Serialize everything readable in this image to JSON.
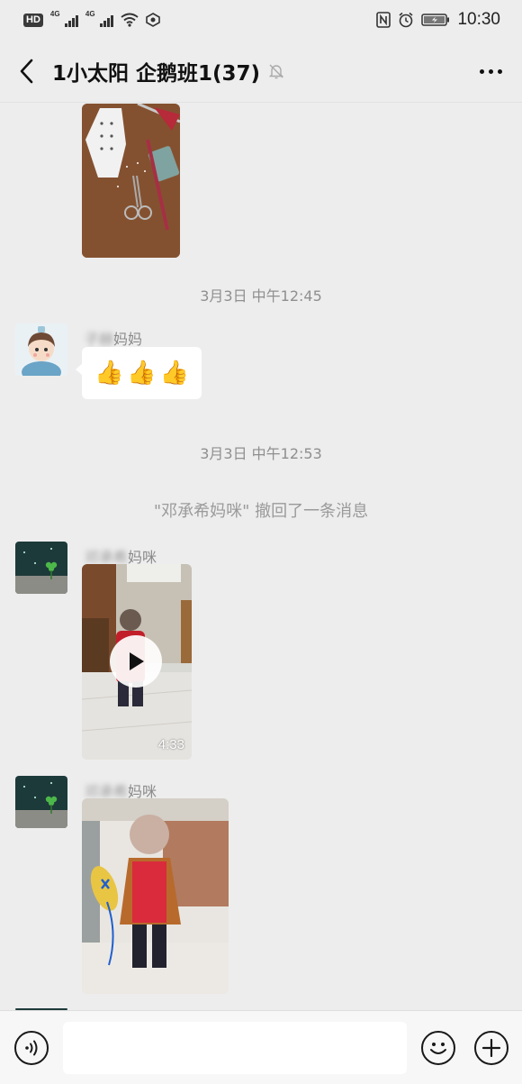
{
  "status_bar": {
    "hd_label": "HD",
    "network_1": "4G",
    "network_2": "4G",
    "time": "10:30",
    "icons": [
      "hd-icon",
      "signal-icon",
      "signal-icon",
      "wifi-icon",
      "data-saver-icon",
      "nfc-icon",
      "alarm-icon",
      "battery-charging-icon"
    ]
  },
  "header": {
    "title": "1小太阳 企鹅班1(37)",
    "back_icon": "chevron-left-icon",
    "mute_icon": "bell-muted-icon",
    "more_icon": "more-dots-icon"
  },
  "messages": {
    "timestamp_1": "3月3日 中午12:45",
    "msg1": {
      "sender_blur": "子赫",
      "sender_suffix": "妈妈",
      "emoji": [
        "👍",
        "👍",
        "👍"
      ]
    },
    "timestamp_2": "3月3日 中午12:53",
    "recall_notice": "\"邓承希妈咪\" 撤回了一条消息",
    "msg2": {
      "sender_blur": "邓承希",
      "sender_suffix": "妈咪",
      "video_duration": "4:33"
    },
    "msg3": {
      "sender_blur": "邓承希",
      "sender_suffix": "妈咪"
    }
  },
  "input_bar": {
    "placeholder": "",
    "icons": [
      "voice-icon",
      "emoji-icon",
      "plus-icon"
    ]
  },
  "colors": {
    "background": "#ededed",
    "bubble": "#ffffff",
    "timestamp_text": "#8f8f8f"
  }
}
